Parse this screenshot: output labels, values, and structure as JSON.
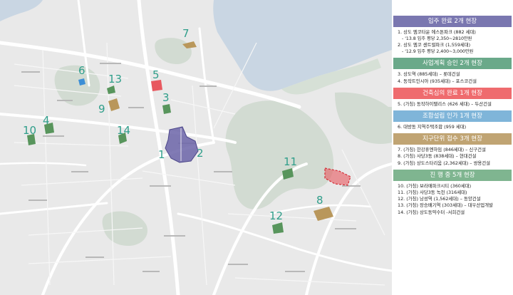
{
  "map": {
    "colors": {
      "water": "#c9d6e3",
      "park": "#cfd8cf",
      "land": "#e9e9e9",
      "road": "#ffffff",
      "label": "#2f9e8a",
      "site_purple": "#6b64a8",
      "site_green": "#58955c",
      "site_gold": "#b9975b",
      "site_red": "#e8585f",
      "site_blue": "#3d8fd6"
    },
    "markers": [
      {
        "label": "1",
        "color": "#2f9e8a"
      },
      {
        "label": "2",
        "color": "#2f9e8a"
      },
      {
        "label": "3",
        "color": "#2f9e8a"
      },
      {
        "label": "4",
        "color": "#2f9e8a"
      },
      {
        "label": "5",
        "color": "#2f9e8a"
      },
      {
        "label": "6",
        "color": "#2f9e8a"
      },
      {
        "label": "7",
        "color": "#2f9e8a"
      },
      {
        "label": "8",
        "color": "#2f9e8a"
      },
      {
        "label": "9",
        "color": "#2f9e8a"
      },
      {
        "label": "10",
        "color": "#2f9e8a"
      },
      {
        "label": "11",
        "color": "#2f9e8a"
      },
      {
        "label": "12",
        "color": "#2f9e8a"
      },
      {
        "label": "13",
        "color": "#2f9e8a"
      },
      {
        "label": "14",
        "color": "#2f9e8a"
      }
    ]
  },
  "panel": {
    "sections": [
      {
        "title": "입주 완료  2개 현장",
        "color": "#7a77b0",
        "items": [
          {
            "text": "1. 상도 엠코타운 에스톤파크 (882 세대)",
            "sub": "- '13.8 입주  평당 2,350~2810만원"
          },
          {
            "text": "2. 상도 엠코 센트럴파크 (1,559세대)",
            "sub": "- '12.9 입주 평당 2,400~3,000만원"
          }
        ]
      },
      {
        "title": "사업계획 승인  2개 현장",
        "color": "#6aa98a",
        "items": [
          {
            "text": "3. 상도역 (885세대) – 롯데건설"
          },
          {
            "text": "4. 동작트인시아 (935세대) – 포스코건설"
          }
        ]
      },
      {
        "title": "건축심의 완료  1개 현장",
        "color": "#ef6b6e",
        "items": [
          {
            "text": "5. (가칭) 동작하이팰리스 (626 세대) – 두산건설"
          }
        ]
      },
      {
        "title": "조합설립 인가  1개 현장",
        "color": "#7fb5d9",
        "items": [
          {
            "text": "6. 대방동 지역주택조합 (959 세대)"
          }
        ]
      },
      {
        "title": "지구단위 접수  3개 현장",
        "color": "#c0a473",
        "items": [
          {
            "text": "7. (가칭) 한강휴엔하임 (846세대) – 신구건설"
          },
          {
            "text": "8. (가칭) 사당3동 (838세대) – 현대건설"
          },
          {
            "text": "9. (가칭) 상도스타리움 (2,362세대) – 쌍용건설"
          }
        ]
      },
      {
        "title": "진 행 중  5개 현장",
        "color": "#7fb590",
        "items": [
          {
            "text": "10. (가칭) 보라매파크시티 (360세대)"
          },
          {
            "text": "11. (가칭) 사당3동 녹천 (316세대)"
          },
          {
            "text": "12. (가칭) 남성역 (1,562세대) – 동양건설"
          },
          {
            "text": "13. (가칭) 장승배기역 (303세대) – 대우산업개발"
          },
          {
            "text": "14. (가칭) 상도동약수터 -서희건설"
          }
        ]
      }
    ]
  }
}
